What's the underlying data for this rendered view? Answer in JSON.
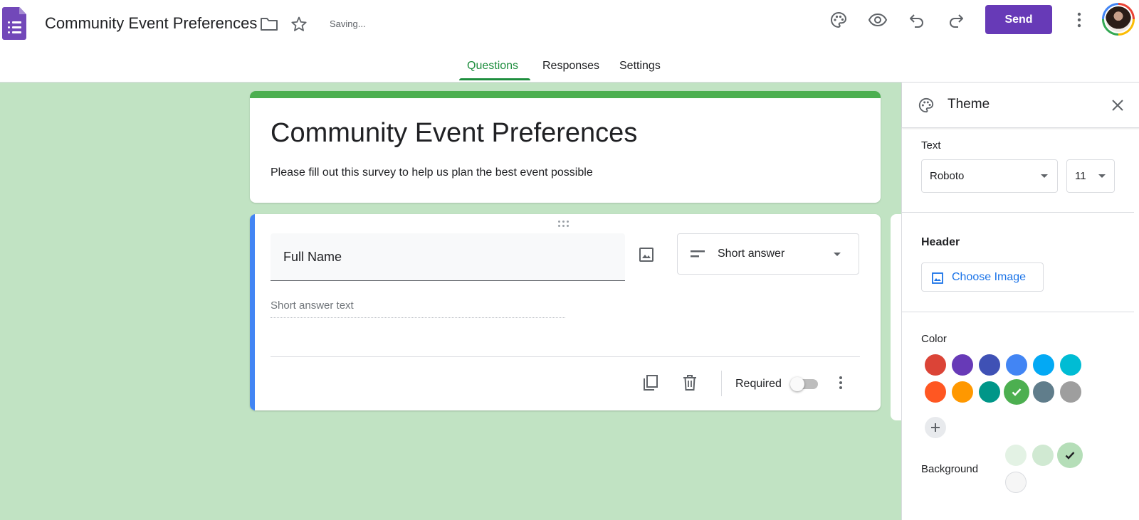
{
  "app": {
    "doc_title": "Community Event Preferences",
    "status": "Saving...",
    "send_label": "Send",
    "icons": [
      "forms-logo-icon",
      "folder-icon",
      "star-icon",
      "palette-icon",
      "eye-icon",
      "undo-icon",
      "redo-icon",
      "more-vert-icon"
    ]
  },
  "tabs": [
    {
      "label": "Questions",
      "active": true
    },
    {
      "label": "Responses"
    },
    {
      "label": "Settings"
    }
  ],
  "form": {
    "title": "Community Event Preferences",
    "description": "Please fill out this survey to help us plan the best event possible",
    "question": {
      "title": "Full Name",
      "type": "Short answer",
      "answer_placeholder": "Short answer text",
      "required_label": "Required",
      "required": false
    }
  },
  "theme_panel": {
    "title": "Theme",
    "text_label": "Text",
    "font": "Roboto",
    "font_size": "11",
    "header_label": "Header",
    "choose_image_label": "Choose Image",
    "color_label": "Color",
    "colors": [
      "#db4437",
      "#673ab7",
      "#3f51b5",
      "#4285f4",
      "#03a9f4",
      "#00bcd4",
      "#ff5722",
      "#ff9800",
      "#009688",
      "#4caf50",
      "#607d8b",
      "#9e9e9e"
    ],
    "selected_color": "#4caf50",
    "background_label": "Background",
    "background_colors": [
      "#e3f2e4",
      "#d0e9d2",
      "#b5deb8",
      "#f6f6f6"
    ],
    "selected_background": "#b5deb8"
  },
  "accent_color": "#673ab7",
  "active_tab_color": "#1e8e3e"
}
